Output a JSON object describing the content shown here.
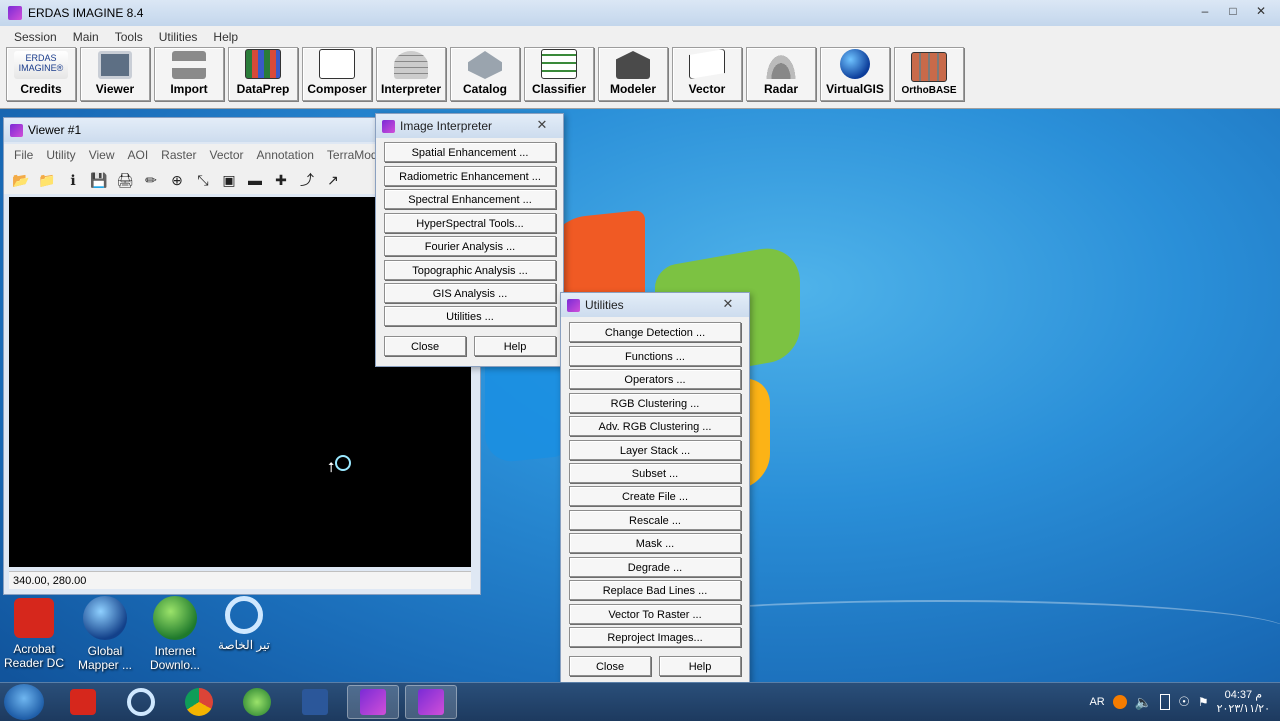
{
  "main_window": {
    "title": "ERDAS IMAGINE 8.4",
    "controls": [
      "–",
      "□",
      "✕"
    ],
    "menu": [
      "Session",
      "Main",
      "Tools",
      "Utilities",
      "Help"
    ],
    "toolbar": [
      {
        "label": "Credits",
        "icon": "erdas-credits-icon",
        "logo_text": "ERDAS\nIMAGINE®"
      },
      {
        "label": "Viewer",
        "icon": "viewer-icon"
      },
      {
        "label": "Import",
        "icon": "import-icon"
      },
      {
        "label": "DataPrep",
        "icon": "dataprep-icon"
      },
      {
        "label": "Composer",
        "icon": "composer-icon"
      },
      {
        "label": "Interpreter",
        "icon": "interpreter-icon"
      },
      {
        "label": "Catalog",
        "icon": "catalog-icon"
      },
      {
        "label": "Classifier",
        "icon": "classifier-icon"
      },
      {
        "label": "Modeler",
        "icon": "modeler-icon"
      },
      {
        "label": "Vector",
        "icon": "vector-icon"
      },
      {
        "label": "Radar",
        "icon": "radar-icon"
      },
      {
        "label": "VirtualGIS",
        "icon": "virtualgis-globe-icon"
      },
      {
        "label": "OrthoBASE",
        "icon": "orthobase-icon"
      }
    ]
  },
  "viewer": {
    "title": "Viewer #1",
    "menu": [
      "File",
      "Utility",
      "View",
      "AOI",
      "Raster",
      "Vector",
      "Annotation",
      "TerraModel"
    ],
    "status": "340.00, 280.00"
  },
  "interpreter": {
    "title": "Image Interpreter",
    "buttons": [
      "Spatial Enhancement ...",
      "Radiometric Enhancement ...",
      "Spectral Enhancement ...",
      "HyperSpectral Tools...",
      "Fourier Analysis ...",
      "Topographic Analysis ...",
      "GIS Analysis ...",
      "Utilities ..."
    ],
    "close": "Close",
    "help": "Help"
  },
  "utilities": {
    "title": "Utilities",
    "buttons": [
      "Change Detection ...",
      "Functions ...",
      "Operators ...",
      "RGB Clustering ...",
      "Adv. RGB Clustering ...",
      "Layer Stack ...",
      "Subset ...",
      "Create File ...",
      "Rescale ...",
      "Mask ...",
      "Degrade ...",
      "Replace Bad Lines ...",
      "Vector To Raster ...",
      "Reproject Images..."
    ],
    "close": "Close",
    "help": "Help"
  },
  "desktop_icons": [
    {
      "label": "Acrobat Reader DC",
      "icon": "acrobat-icon"
    },
    {
      "label": "Global Mapper ...",
      "icon": "globe-icon"
    },
    {
      "label": "Internet Downlo...",
      "icon": "idm-icon"
    },
    {
      "label": "تير الخاصة",
      "icon": "search-folder-icon"
    }
  ],
  "taskbar": {
    "items": [
      "start-orb-icon",
      "acrobat-icon",
      "search-icon",
      "chrome-icon",
      "idm-icon",
      "word-icon",
      "erdas-icon",
      "erdas-icon"
    ],
    "lang": "AR",
    "time": "04:37 م",
    "date": "٢٠٢٣/١١/٢٠"
  }
}
